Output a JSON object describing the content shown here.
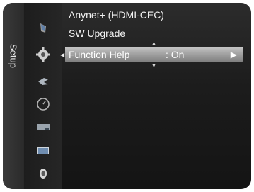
{
  "side_label": "Setup",
  "icons": [
    {
      "name": "picture-icon"
    },
    {
      "name": "setup-gear-icon"
    },
    {
      "name": "input-icon"
    },
    {
      "name": "clock-icon"
    },
    {
      "name": "channel-icon"
    },
    {
      "name": "display-icon"
    },
    {
      "name": "sound-icon"
    }
  ],
  "menu": {
    "items": [
      {
        "label": "Anynet+ (HDMI-CEC)"
      },
      {
        "label": "SW Upgrade"
      },
      {
        "label": "Function Help",
        "value": ": On",
        "arrow": "▶"
      }
    ],
    "scroll_up": "▲",
    "scroll_down": "▼",
    "active_marker": "◀"
  },
  "colors": {
    "frame": "#1c1c1c",
    "highlight": "#a6a6a6",
    "text": "#f2f2f2"
  }
}
